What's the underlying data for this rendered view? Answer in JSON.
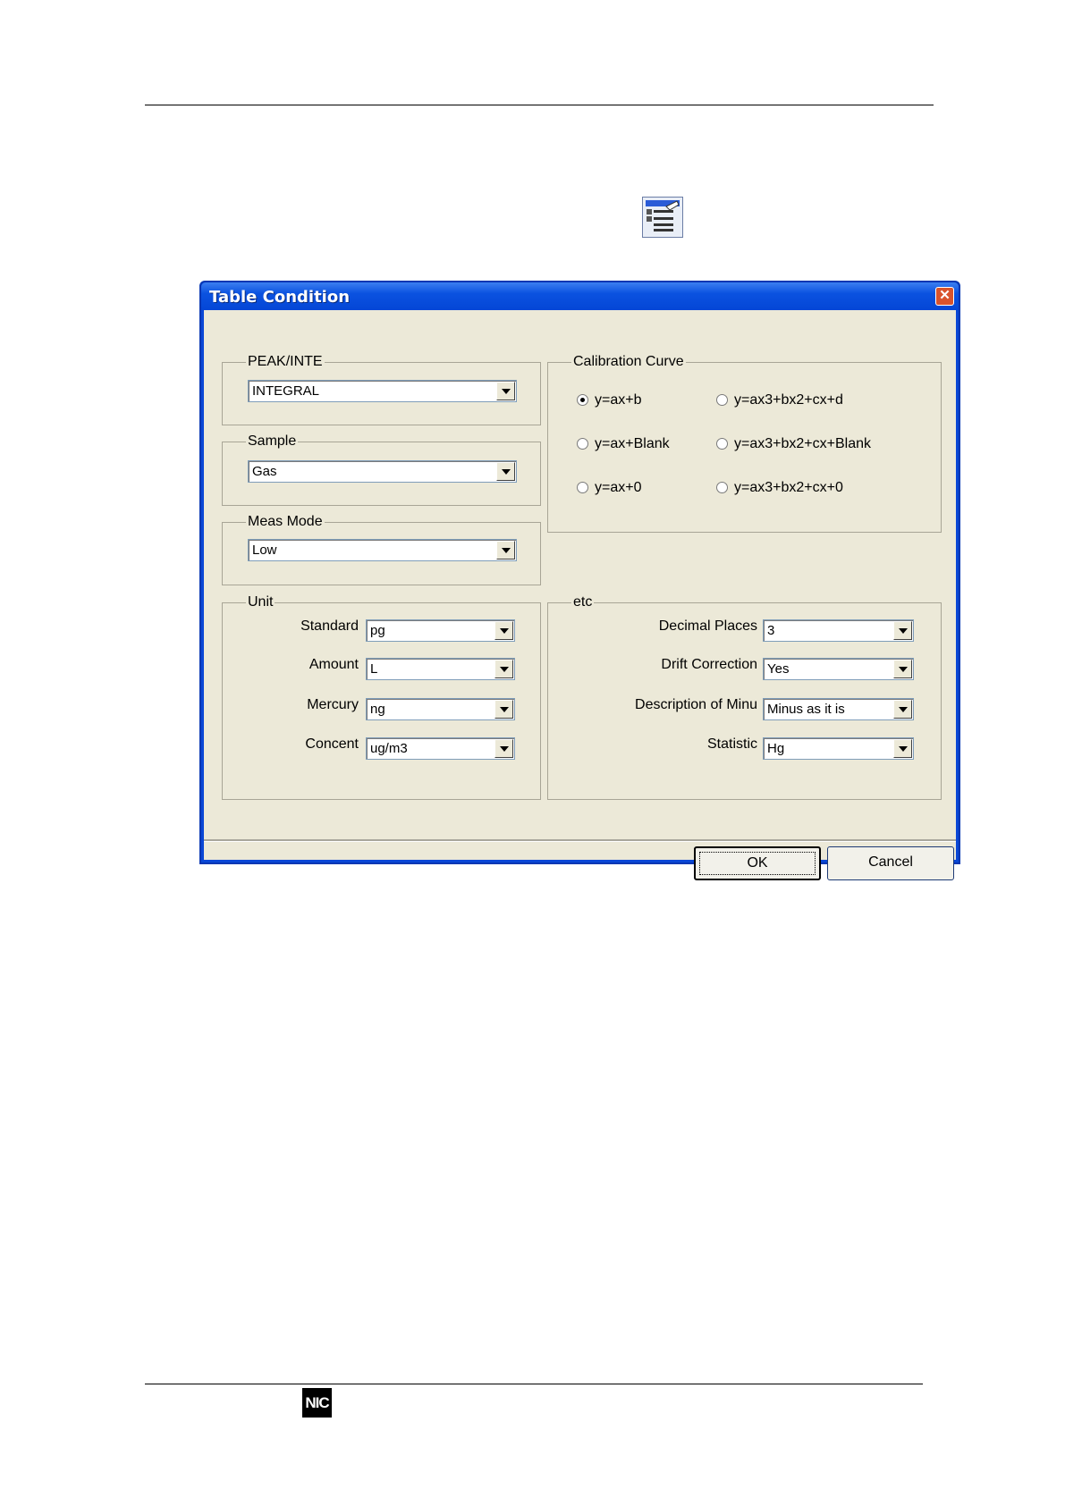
{
  "page": {
    "toolbar_icon": "table-condition-icon",
    "logo_text": "NIC"
  },
  "dialog": {
    "title": "Table Condition",
    "close_icon": "close-icon",
    "peak_inte": {
      "legend": "PEAK/INTE",
      "value": "INTEGRAL"
    },
    "sample": {
      "legend": "Sample",
      "value": "Gas"
    },
    "meas_mode": {
      "legend": "Meas Mode",
      "value": "Low"
    },
    "calibration": {
      "legend": "Calibration Curve",
      "options": [
        {
          "label": "y=ax+b",
          "checked": true
        },
        {
          "label": "y=ax3+bx2+cx+d",
          "checked": false
        },
        {
          "label": "y=ax+Blank",
          "checked": false
        },
        {
          "label": "y=ax3+bx2+cx+Blank",
          "checked": false
        },
        {
          "label": "y=ax+0",
          "checked": false
        },
        {
          "label": "y=ax3+bx2+cx+0",
          "checked": false
        }
      ]
    },
    "unit": {
      "legend": "Unit",
      "fields": [
        {
          "label": "Standard",
          "value": "pg"
        },
        {
          "label": "Amount",
          "value": "L"
        },
        {
          "label": "Mercury",
          "value": "ng"
        },
        {
          "label": "Concent",
          "value": "ug/m3"
        }
      ]
    },
    "etc": {
      "legend": "etc",
      "fields": [
        {
          "label": "Decimal Places",
          "value": "3"
        },
        {
          "label": "Drift Correction",
          "value": "Yes"
        },
        {
          "label": "Description of Minu",
          "value": "Minus as it is"
        },
        {
          "label": "Statistic",
          "value": "Hg"
        }
      ]
    },
    "ok_label": "OK",
    "cancel_label": "Cancel"
  }
}
